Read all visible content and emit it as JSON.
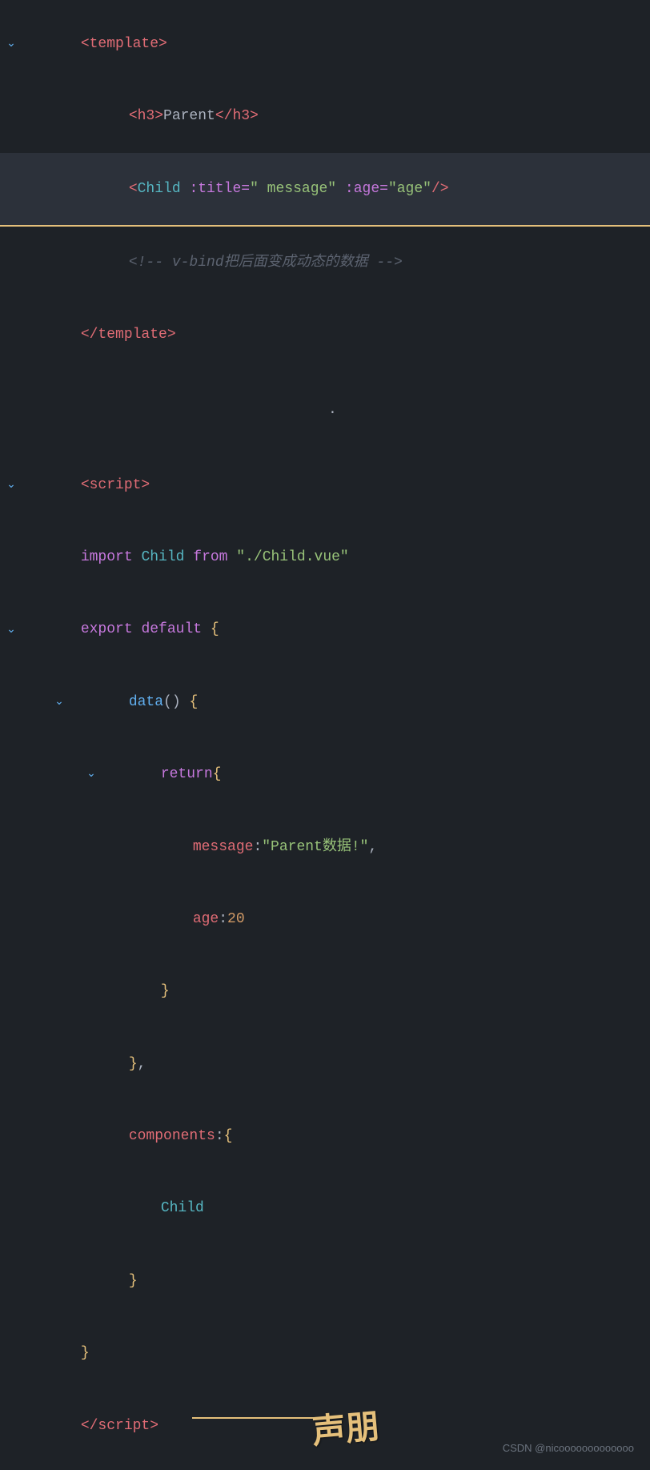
{
  "editor": {
    "background": "#1e2227",
    "lines": [
      {
        "id": 1,
        "indent": 0,
        "gutter": "v",
        "content": "template_open"
      },
      {
        "id": 2,
        "indent": 1,
        "gutter": "",
        "content": "h3_parent"
      },
      {
        "id": 3,
        "indent": 1,
        "gutter": "",
        "content": "child_tag",
        "highlight": true
      },
      {
        "id": 4,
        "indent": 1,
        "gutter": "",
        "content": "comment_vbind"
      },
      {
        "id": 5,
        "indent": 0,
        "gutter": "",
        "content": "template_close"
      },
      {
        "id": 6,
        "indent": 0,
        "gutter": "",
        "content": "blank"
      },
      {
        "id": 7,
        "indent": 0,
        "gutter": "",
        "content": "dot"
      },
      {
        "id": 8,
        "indent": 0,
        "gutter": "",
        "content": "blank"
      },
      {
        "id": 9,
        "indent": 0,
        "gutter": "v",
        "content": "script_open"
      },
      {
        "id": 10,
        "indent": 0,
        "gutter": "",
        "content": "import_child"
      },
      {
        "id": 11,
        "indent": 0,
        "gutter": "v",
        "content": "export_default"
      },
      {
        "id": 12,
        "indent": 1,
        "gutter": "v",
        "content": "data_func"
      },
      {
        "id": 13,
        "indent": 2,
        "gutter": "v",
        "content": "return_open"
      },
      {
        "id": 14,
        "indent": 3,
        "gutter": "",
        "content": "message_prop"
      },
      {
        "id": 15,
        "indent": 3,
        "gutter": "",
        "content": "age_prop"
      },
      {
        "id": 16,
        "indent": 2,
        "gutter": "",
        "content": "brace_close"
      },
      {
        "id": 17,
        "indent": 1,
        "gutter": "",
        "content": "brace_close_comma"
      },
      {
        "id": 18,
        "indent": 1,
        "gutter": "",
        "content": "components_open"
      },
      {
        "id": 19,
        "indent": 2,
        "gutter": "",
        "content": "child_identifier"
      },
      {
        "id": 20,
        "indent": 1,
        "gutter": "",
        "content": "brace_close_only"
      },
      {
        "id": 21,
        "indent": 0,
        "gutter": "",
        "content": "brace_close_only"
      },
      {
        "id": 22,
        "indent": 0,
        "gutter": "",
        "content": "script_close"
      }
    ]
  },
  "footer": {
    "text": "CSDN @nicooooooooooooo"
  },
  "annotation": {
    "text": "声朋",
    "line_present": true
  }
}
